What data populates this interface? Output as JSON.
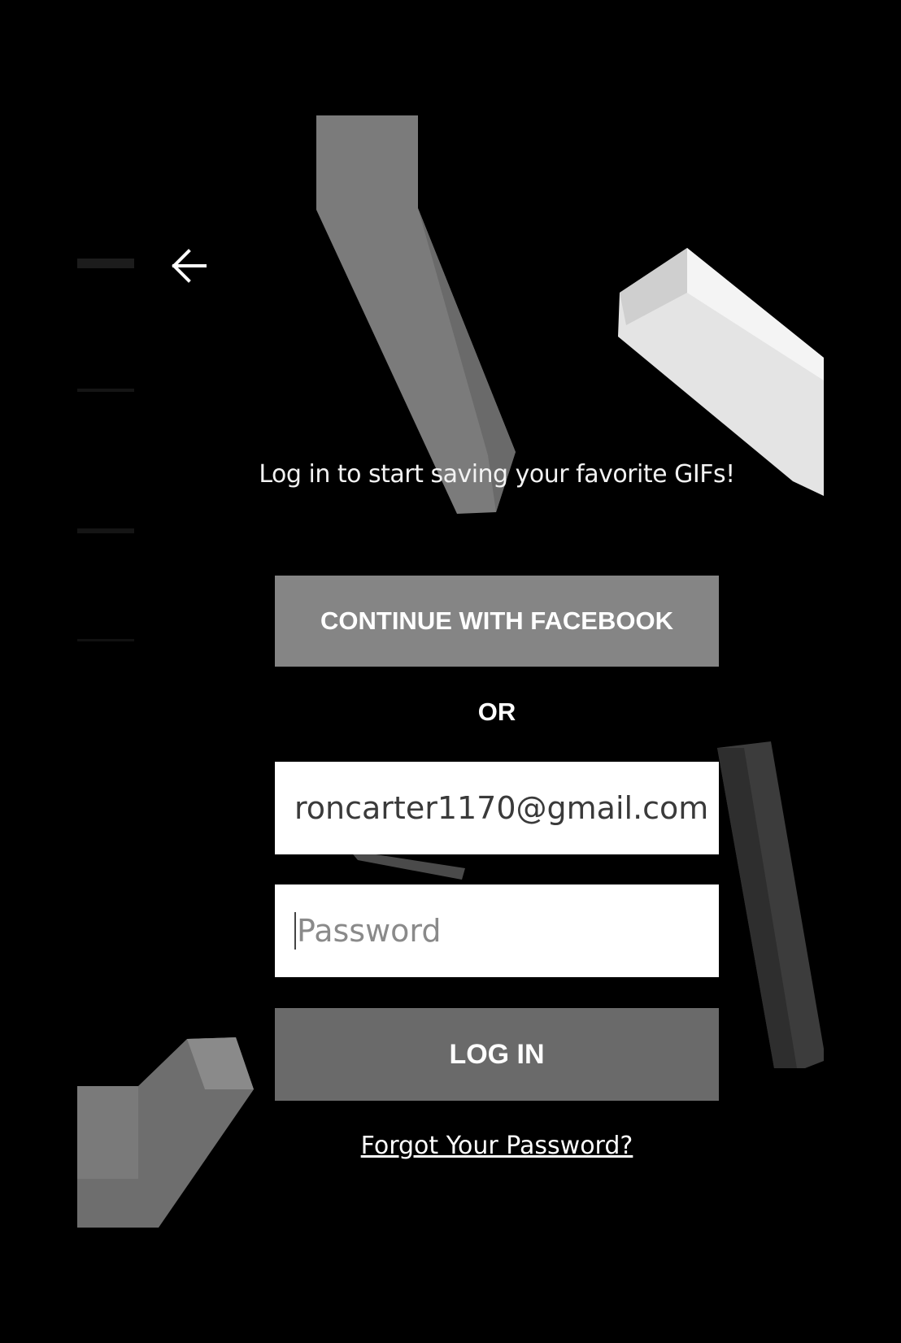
{
  "login": {
    "tagline": "Log in to start saving your favorite GIFs!",
    "facebook_label": "CONTINUE WITH FACEBOOK",
    "or_label": "OR",
    "email_value": "roncarter1170@gmail.com",
    "password_placeholder": "Password",
    "login_label": "LOG IN",
    "forgot_label": "Forgot Your Password?"
  },
  "icons": {
    "back": "arrow-left-icon"
  },
  "colors": {
    "background": "#000000",
    "facebook_button": "#858585",
    "login_button": "#6a6a6a",
    "text": "#ffffff"
  }
}
